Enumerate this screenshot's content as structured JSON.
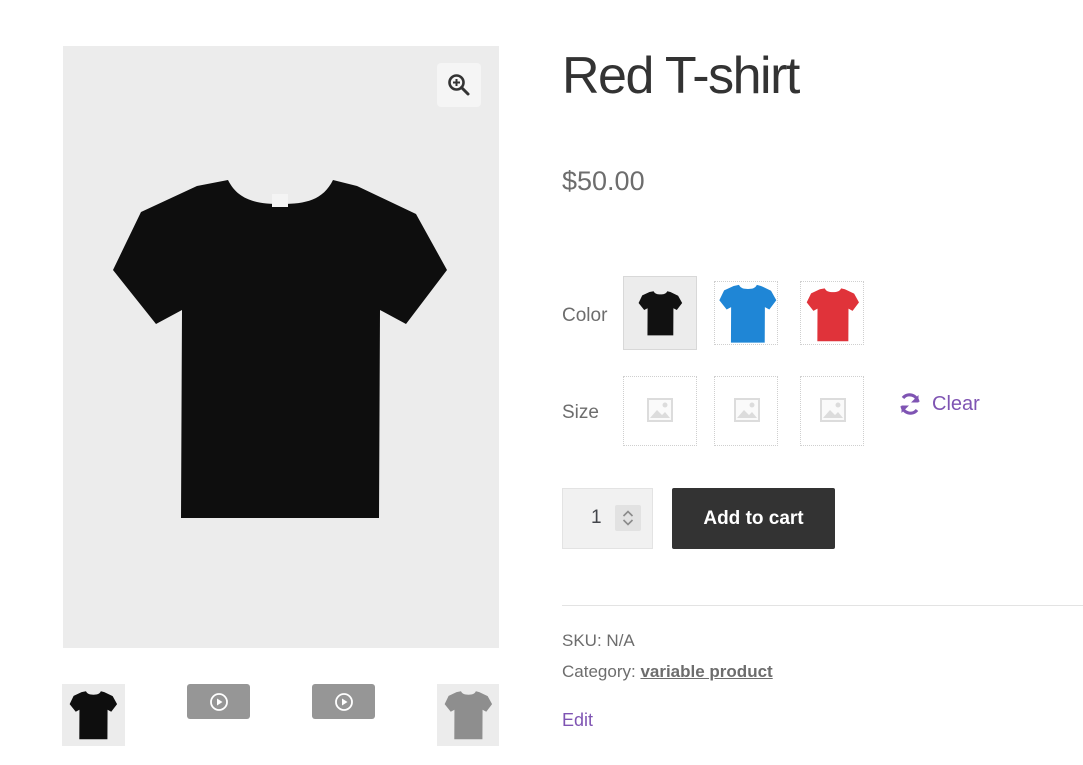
{
  "product": {
    "title": "Red T-shirt",
    "price": "$50.00",
    "sku_label": "SKU:",
    "sku_value": "N/A",
    "category_label": "Category:",
    "category_value": "variable product",
    "edit_label": "Edit"
  },
  "gallery": {
    "main_image": "black-tshirt",
    "zoom_icon": "zoom-in-icon",
    "thumbnails": [
      {
        "type": "image",
        "image": "black-tshirt"
      },
      {
        "type": "video",
        "icon": "play-icon"
      },
      {
        "type": "video",
        "icon": "play-icon"
      },
      {
        "type": "image",
        "image": "gray-tshirt"
      }
    ]
  },
  "attributes": {
    "color_label": "Color",
    "size_label": "Size",
    "color_swatches": [
      {
        "name": "black",
        "hex": "#111111",
        "selected": true
      },
      {
        "name": "blue",
        "hex": "#1f86d6",
        "selected": false
      },
      {
        "name": "red",
        "hex": "#e0333a",
        "selected": false
      }
    ],
    "size_swatches": [
      {
        "icon": "placeholder-image-icon"
      },
      {
        "icon": "placeholder-image-icon"
      },
      {
        "icon": "placeholder-image-icon"
      }
    ],
    "clear_label": "Clear",
    "clear_icon": "refresh-icon"
  },
  "cart": {
    "quantity": "1",
    "add_to_cart_label": "Add to cart"
  },
  "colors": {
    "accent": "#7f54b3",
    "button": "#333333",
    "gallery_bg": "#ececec"
  }
}
